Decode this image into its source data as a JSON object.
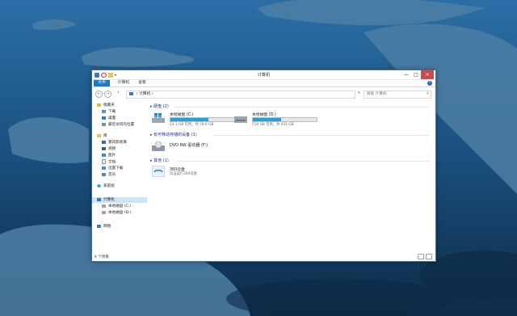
{
  "window": {
    "title": "计算机",
    "controls": {
      "minimize": "—",
      "maximize": "□",
      "close": "✕"
    },
    "ribbon_tabs": [
      "文件",
      "计算机",
      "查看"
    ],
    "help": "?"
  },
  "navbar": {
    "back": "←",
    "forward": "→",
    "up": "↑",
    "address": "计算机",
    "address_sep": "›",
    "refresh": "↻",
    "search_placeholder": "搜索 计算机"
  },
  "nav": {
    "favorites": "收藏夹",
    "favorites_items": [
      "下载",
      "桌面",
      "最近访问的位置"
    ],
    "libraries": "库",
    "library_items": [
      "暴风影视库",
      "视频",
      "图片",
      "文档",
      "迅雷下载",
      "音乐"
    ],
    "homegroup": "家庭组",
    "computer": "计算机",
    "computer_items": [
      "本地磁盘 (C:)",
      "本地磁盘 (D:)"
    ],
    "network": "网络"
  },
  "groups": {
    "hard_drives": "硬盘 (2)",
    "removable": "有可移动存储的设备 (1)",
    "other": "其他 (1)"
  },
  "drives": [
    {
      "name": "本地磁盘 (C:)",
      "size": "24.3 GB 可用，共 59.6 GB",
      "used_fraction": 0.59
    },
    {
      "name": "本地磁盘 (D:)",
      "size": "519 GB 可用，共 931 GB",
      "used_fraction": 0.44
    }
  ],
  "dvd": {
    "name": "DVD RW 驱动器 (F:)"
  },
  "other_item": {
    "name": "360云盘",
    "sub": "双击运行360云盘"
  },
  "status": {
    "count": "4 个项目"
  },
  "colors": {
    "accent": "#1979ca",
    "drive_fill": "#26a0da",
    "group_title": "#1e3287"
  }
}
